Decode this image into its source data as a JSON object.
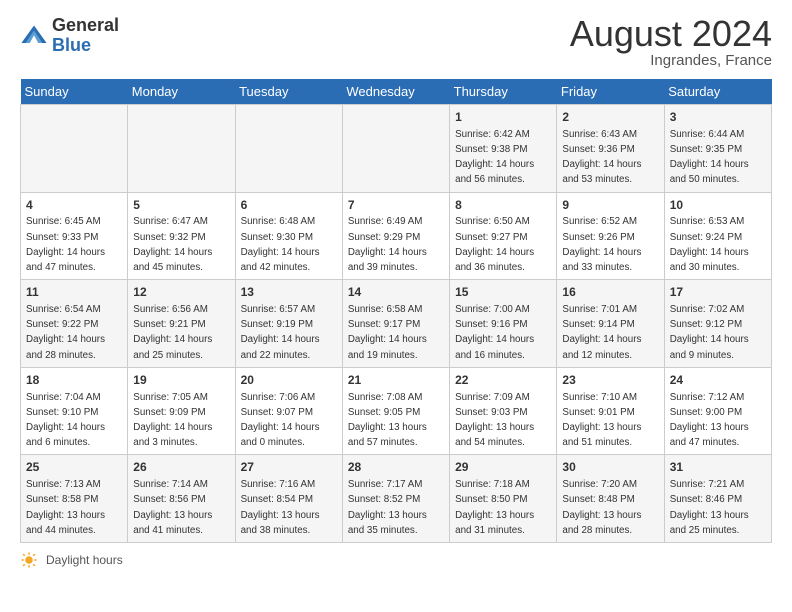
{
  "header": {
    "logo_general": "General",
    "logo_blue": "Blue",
    "month_title": "August 2024",
    "location": "Ingrandes, France"
  },
  "days_of_week": [
    "Sunday",
    "Monday",
    "Tuesday",
    "Wednesday",
    "Thursday",
    "Friday",
    "Saturday"
  ],
  "footer": {
    "daylight_label": "Daylight hours"
  },
  "weeks": [
    [
      {
        "day": "",
        "info": ""
      },
      {
        "day": "",
        "info": ""
      },
      {
        "day": "",
        "info": ""
      },
      {
        "day": "",
        "info": ""
      },
      {
        "day": "1",
        "info": "Sunrise: 6:42 AM\nSunset: 9:38 PM\nDaylight: 14 hours\nand 56 minutes."
      },
      {
        "day": "2",
        "info": "Sunrise: 6:43 AM\nSunset: 9:36 PM\nDaylight: 14 hours\nand 53 minutes."
      },
      {
        "day": "3",
        "info": "Sunrise: 6:44 AM\nSunset: 9:35 PM\nDaylight: 14 hours\nand 50 minutes."
      }
    ],
    [
      {
        "day": "4",
        "info": "Sunrise: 6:45 AM\nSunset: 9:33 PM\nDaylight: 14 hours\nand 47 minutes."
      },
      {
        "day": "5",
        "info": "Sunrise: 6:47 AM\nSunset: 9:32 PM\nDaylight: 14 hours\nand 45 minutes."
      },
      {
        "day": "6",
        "info": "Sunrise: 6:48 AM\nSunset: 9:30 PM\nDaylight: 14 hours\nand 42 minutes."
      },
      {
        "day": "7",
        "info": "Sunrise: 6:49 AM\nSunset: 9:29 PM\nDaylight: 14 hours\nand 39 minutes."
      },
      {
        "day": "8",
        "info": "Sunrise: 6:50 AM\nSunset: 9:27 PM\nDaylight: 14 hours\nand 36 minutes."
      },
      {
        "day": "9",
        "info": "Sunrise: 6:52 AM\nSunset: 9:26 PM\nDaylight: 14 hours\nand 33 minutes."
      },
      {
        "day": "10",
        "info": "Sunrise: 6:53 AM\nSunset: 9:24 PM\nDaylight: 14 hours\nand 30 minutes."
      }
    ],
    [
      {
        "day": "11",
        "info": "Sunrise: 6:54 AM\nSunset: 9:22 PM\nDaylight: 14 hours\nand 28 minutes."
      },
      {
        "day": "12",
        "info": "Sunrise: 6:56 AM\nSunset: 9:21 PM\nDaylight: 14 hours\nand 25 minutes."
      },
      {
        "day": "13",
        "info": "Sunrise: 6:57 AM\nSunset: 9:19 PM\nDaylight: 14 hours\nand 22 minutes."
      },
      {
        "day": "14",
        "info": "Sunrise: 6:58 AM\nSunset: 9:17 PM\nDaylight: 14 hours\nand 19 minutes."
      },
      {
        "day": "15",
        "info": "Sunrise: 7:00 AM\nSunset: 9:16 PM\nDaylight: 14 hours\nand 16 minutes."
      },
      {
        "day": "16",
        "info": "Sunrise: 7:01 AM\nSunset: 9:14 PM\nDaylight: 14 hours\nand 12 minutes."
      },
      {
        "day": "17",
        "info": "Sunrise: 7:02 AM\nSunset: 9:12 PM\nDaylight: 14 hours\nand 9 minutes."
      }
    ],
    [
      {
        "day": "18",
        "info": "Sunrise: 7:04 AM\nSunset: 9:10 PM\nDaylight: 14 hours\nand 6 minutes."
      },
      {
        "day": "19",
        "info": "Sunrise: 7:05 AM\nSunset: 9:09 PM\nDaylight: 14 hours\nand 3 minutes."
      },
      {
        "day": "20",
        "info": "Sunrise: 7:06 AM\nSunset: 9:07 PM\nDaylight: 14 hours\nand 0 minutes."
      },
      {
        "day": "21",
        "info": "Sunrise: 7:08 AM\nSunset: 9:05 PM\nDaylight: 13 hours\nand 57 minutes."
      },
      {
        "day": "22",
        "info": "Sunrise: 7:09 AM\nSunset: 9:03 PM\nDaylight: 13 hours\nand 54 minutes."
      },
      {
        "day": "23",
        "info": "Sunrise: 7:10 AM\nSunset: 9:01 PM\nDaylight: 13 hours\nand 51 minutes."
      },
      {
        "day": "24",
        "info": "Sunrise: 7:12 AM\nSunset: 9:00 PM\nDaylight: 13 hours\nand 47 minutes."
      }
    ],
    [
      {
        "day": "25",
        "info": "Sunrise: 7:13 AM\nSunset: 8:58 PM\nDaylight: 13 hours\nand 44 minutes."
      },
      {
        "day": "26",
        "info": "Sunrise: 7:14 AM\nSunset: 8:56 PM\nDaylight: 13 hours\nand 41 minutes."
      },
      {
        "day": "27",
        "info": "Sunrise: 7:16 AM\nSunset: 8:54 PM\nDaylight: 13 hours\nand 38 minutes."
      },
      {
        "day": "28",
        "info": "Sunrise: 7:17 AM\nSunset: 8:52 PM\nDaylight: 13 hours\nand 35 minutes."
      },
      {
        "day": "29",
        "info": "Sunrise: 7:18 AM\nSunset: 8:50 PM\nDaylight: 13 hours\nand 31 minutes."
      },
      {
        "day": "30",
        "info": "Sunrise: 7:20 AM\nSunset: 8:48 PM\nDaylight: 13 hours\nand 28 minutes."
      },
      {
        "day": "31",
        "info": "Sunrise: 7:21 AM\nSunset: 8:46 PM\nDaylight: 13 hours\nand 25 minutes."
      }
    ]
  ]
}
